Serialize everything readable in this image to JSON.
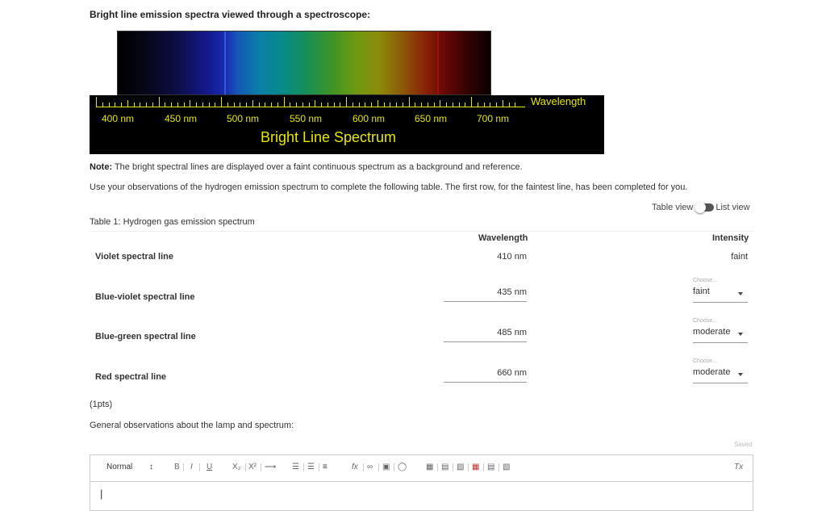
{
  "heading": "Bright line emission spectra viewed through a spectroscope:",
  "figure": {
    "wavelength_label": "Wavelength",
    "tick_labels": [
      "400 nm",
      "450 nm",
      "500 nm",
      "550 nm",
      "600 nm",
      "650 nm",
      "700 nm"
    ],
    "caption": "Bright Line Spectrum",
    "line_colors": [
      "#2a5fd8",
      "#a01010"
    ]
  },
  "note_label": "Note:",
  "note_text": " The bright spectral lines are displayed over a faint continuous spectrum as a background and reference.",
  "instructions": "Use your observations of the hydrogen emission spectrum to complete the following table. The first row, for the faintest line, has been completed for you.",
  "view_toggle": {
    "table_label": "Table view",
    "list_label": "List view"
  },
  "table": {
    "caption": "Table 1: Hydrogen gas emission spectrum",
    "col_wavelength": "Wavelength",
    "col_intensity": "Intensity",
    "choose_label": "Choose...",
    "rows": [
      {
        "label": "Violet spectral line",
        "wavelength": "410 nm",
        "intensity": "faint"
      },
      {
        "label": "Blue-violet spectral line",
        "wavelength": "435 nm",
        "intensity": "faint"
      },
      {
        "label": "Blue-green spectral line",
        "wavelength": "485 nm",
        "intensity": "moderate"
      },
      {
        "label": "Red spectral line",
        "wavelength": "660 nm",
        "intensity": "moderate"
      }
    ]
  },
  "points": "(1pts)",
  "general_prompt": "General observations about the lamp and spectrum:",
  "saved": "Saved",
  "editor": {
    "format_select": "Normal",
    "bold": "B",
    "italic": "I",
    "underline": "U",
    "subscript": "X₂",
    "superscript": "X²",
    "formula": "fx",
    "clear_format": "Tx",
    "body": "|"
  }
}
